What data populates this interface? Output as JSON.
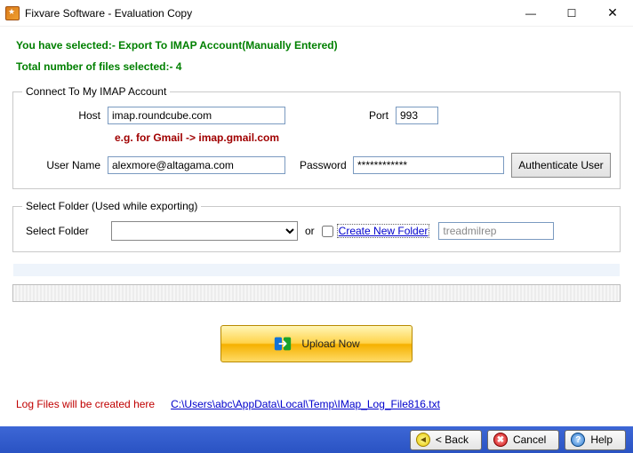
{
  "window": {
    "title": "Fixvare Software - Evaluation Copy"
  },
  "summary": {
    "line1": "You have selected:- Export To IMAP Account(Manually Entered)",
    "line2": "Total number of files selected:- 4"
  },
  "imap": {
    "legend": "Connect To My IMAP Account",
    "host_label": "Host",
    "host_value": "imap.roundcube.com",
    "port_label": "Port",
    "port_value": "993",
    "hint": "e.g. for Gmail -> imap.gmail.com",
    "user_label": "User Name",
    "user_value": "alexmore@altagama.com",
    "password_label": "Password",
    "password_value": "************",
    "auth_button": "Authenticate User"
  },
  "folder": {
    "legend": "Select Folder (Used while exporting)",
    "select_label": "Select Folder",
    "or": "or",
    "create_label": "Create New Folder",
    "new_folder_value": "treadmilrep"
  },
  "upload": {
    "label": "Upload Now"
  },
  "log": {
    "text": "Log Files will be created here",
    "path": "C:\\Users\\abc\\AppData\\Local\\Temp\\IMap_Log_File816.txt"
  },
  "footer": {
    "back": "< Back",
    "cancel": "Cancel",
    "help": "Help"
  }
}
